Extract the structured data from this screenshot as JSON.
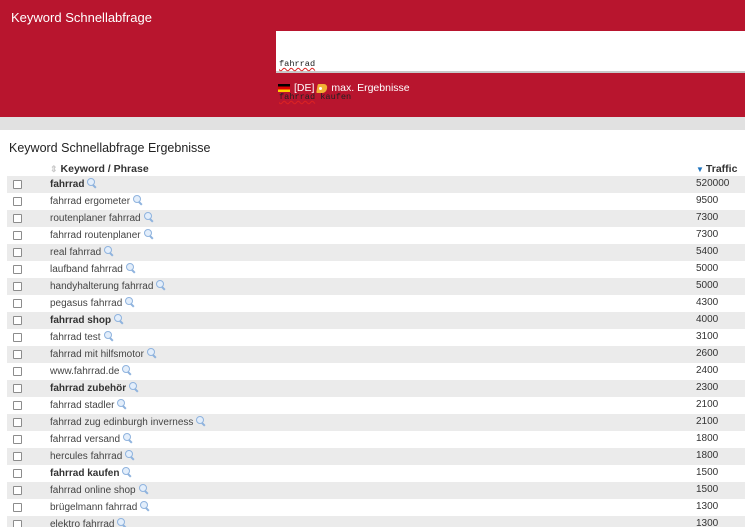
{
  "app": {
    "title": "Keyword Schnellabfrage"
  },
  "query": {
    "lines": [
      "fahrrad",
      "fahrrad kaufen"
    ]
  },
  "options": {
    "country": "[DE]",
    "max_results": "max. Ergebnisse",
    "icons": [
      "flag-de-icon",
      "tag-icon"
    ]
  },
  "results": {
    "title": "Keyword Schnellabfrage Ergebnisse",
    "columns": {
      "keyword": "Keyword / Phrase",
      "traffic": "Traffic"
    },
    "rows": [
      {
        "keyword": "fahrrad",
        "traffic": "520000",
        "bold": true
      },
      {
        "keyword": "fahrrad ergometer",
        "traffic": "9500",
        "bold": false
      },
      {
        "keyword": "routenplaner fahrrad",
        "traffic": "7300",
        "bold": false
      },
      {
        "keyword": "fahrrad routenplaner",
        "traffic": "7300",
        "bold": false
      },
      {
        "keyword": "real fahrrad",
        "traffic": "5400",
        "bold": false
      },
      {
        "keyword": "laufband fahrrad",
        "traffic": "5000",
        "bold": false
      },
      {
        "keyword": "handyhalterung fahrrad",
        "traffic": "5000",
        "bold": false
      },
      {
        "keyword": "pegasus fahrrad",
        "traffic": "4300",
        "bold": false
      },
      {
        "keyword": "fahrrad shop",
        "traffic": "4000",
        "bold": true
      },
      {
        "keyword": "fahrrad test",
        "traffic": "3100",
        "bold": false
      },
      {
        "keyword": "fahrrad mit hilfsmotor",
        "traffic": "2600",
        "bold": false
      },
      {
        "keyword": "www.fahrrad.de",
        "traffic": "2400",
        "bold": false
      },
      {
        "keyword": "fahrrad zubehör",
        "traffic": "2300",
        "bold": true
      },
      {
        "keyword": "fahrrad stadler",
        "traffic": "2100",
        "bold": false
      },
      {
        "keyword": "fahrrad zug edinburgh inverness",
        "traffic": "2100",
        "bold": false
      },
      {
        "keyword": "fahrrad versand",
        "traffic": "1800",
        "bold": false
      },
      {
        "keyword": "hercules fahrrad",
        "traffic": "1800",
        "bold": false
      },
      {
        "keyword": "fahrrad kaufen",
        "traffic": "1500",
        "bold": true
      },
      {
        "keyword": "fahrrad online shop",
        "traffic": "1500",
        "bold": false
      },
      {
        "keyword": "brügelmann fahrrad",
        "traffic": "1300",
        "bold": false
      },
      {
        "keyword": "elektro fahrrad",
        "traffic": "1300",
        "bold": false
      }
    ]
  },
  "colors": {
    "header_bg": "#b8152e",
    "band": "#e1e1e1",
    "row_alt": "#ebebeb",
    "sort_accent": "#1e73be"
  }
}
